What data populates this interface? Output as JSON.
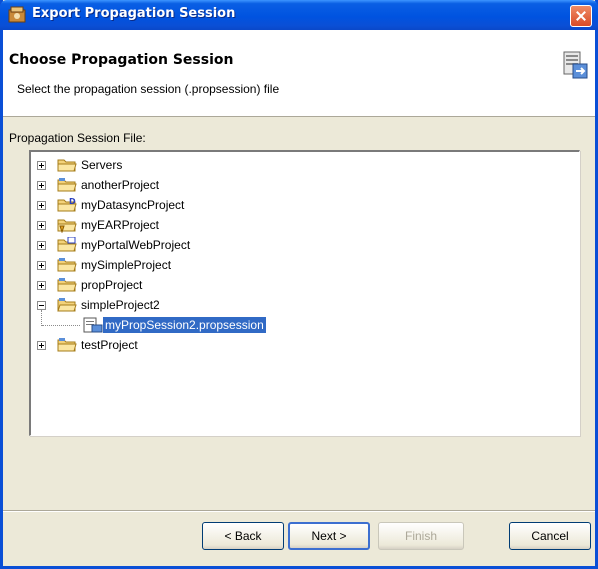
{
  "window": {
    "title": "Export Propagation Session"
  },
  "banner": {
    "title": "Choose Propagation Session",
    "description": "Select the propagation session (.propsession) file"
  },
  "field": {
    "label": "Propagation Session File:"
  },
  "tree": {
    "items": [
      {
        "label": "Servers",
        "expanded": false,
        "icon": "folder-icon"
      },
      {
        "label": "anotherProject",
        "expanded": false,
        "icon": "project-folder-icon"
      },
      {
        "label": "myDatasyncProject",
        "expanded": false,
        "icon": "datasync-project-icon"
      },
      {
        "label": "myEARProject",
        "expanded": false,
        "icon": "ear-project-icon"
      },
      {
        "label": "myPortalWebProject",
        "expanded": false,
        "icon": "portal-web-project-icon"
      },
      {
        "label": "mySimpleProject",
        "expanded": false,
        "icon": "project-folder-icon"
      },
      {
        "label": "propProject",
        "expanded": false,
        "icon": "project-folder-icon"
      },
      {
        "label": "simpleProject2",
        "expanded": true,
        "icon": "project-folder-icon"
      },
      {
        "label": "myPropSession2.propsession",
        "selected": true,
        "icon": "propsession-file-icon"
      },
      {
        "label": "testProject",
        "expanded": false,
        "icon": "project-folder-icon"
      }
    ]
  },
  "buttons": {
    "back": "< Back",
    "next": "Next >",
    "finish": "Finish",
    "cancel": "Cancel"
  },
  "colors": {
    "title_bar": "#0a4fd6",
    "selection": "#316ac5",
    "dialog_face": "#ece9d8"
  }
}
